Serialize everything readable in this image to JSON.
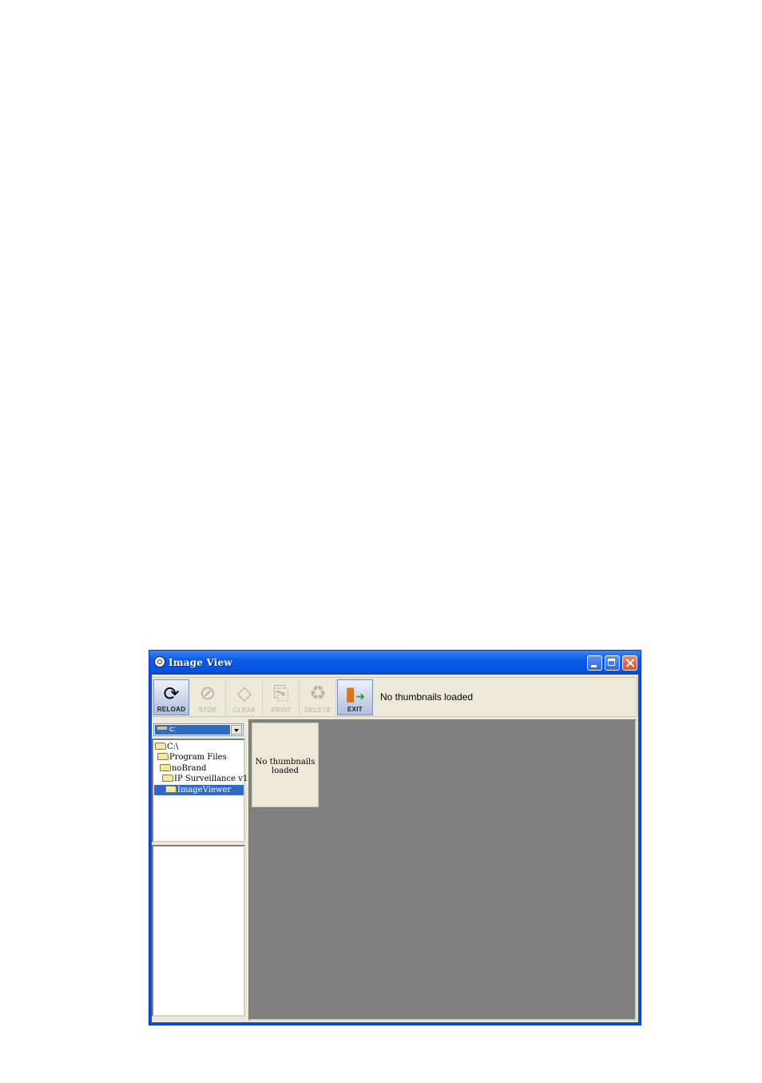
{
  "window": {
    "title": "Image View"
  },
  "toolbar": {
    "buttons": [
      {
        "label": "RELOAD",
        "icon": "reload-icon",
        "enabled": true
      },
      {
        "label": "STOP",
        "icon": "stop-icon",
        "enabled": false
      },
      {
        "label": "CLEAR",
        "icon": "eraser-icon",
        "enabled": false
      },
      {
        "label": "PRINT",
        "icon": "printer-icon",
        "enabled": false
      },
      {
        "label": "DELETE",
        "icon": "trash-icon",
        "enabled": false
      },
      {
        "label": "EXIT",
        "icon": "exit-door-icon",
        "enabled": true
      }
    ],
    "status": "No thumbnails loaded"
  },
  "drive_select": {
    "value": "c:"
  },
  "folder_tree": {
    "items": [
      {
        "label": "C:\\"
      },
      {
        "label": "Program Files"
      },
      {
        "label": "noBrand"
      },
      {
        "label": "IP Surveillance  v1"
      },
      {
        "label": "ImageViewer",
        "selected": true
      }
    ]
  },
  "thumbnails": {
    "placeholder": "No thumbnails loaded"
  },
  "colors": {
    "titlebar": "#0a5be8",
    "selection": "#316ac5",
    "thumb_background": "#808080",
    "window_face": "#ece9d8"
  }
}
